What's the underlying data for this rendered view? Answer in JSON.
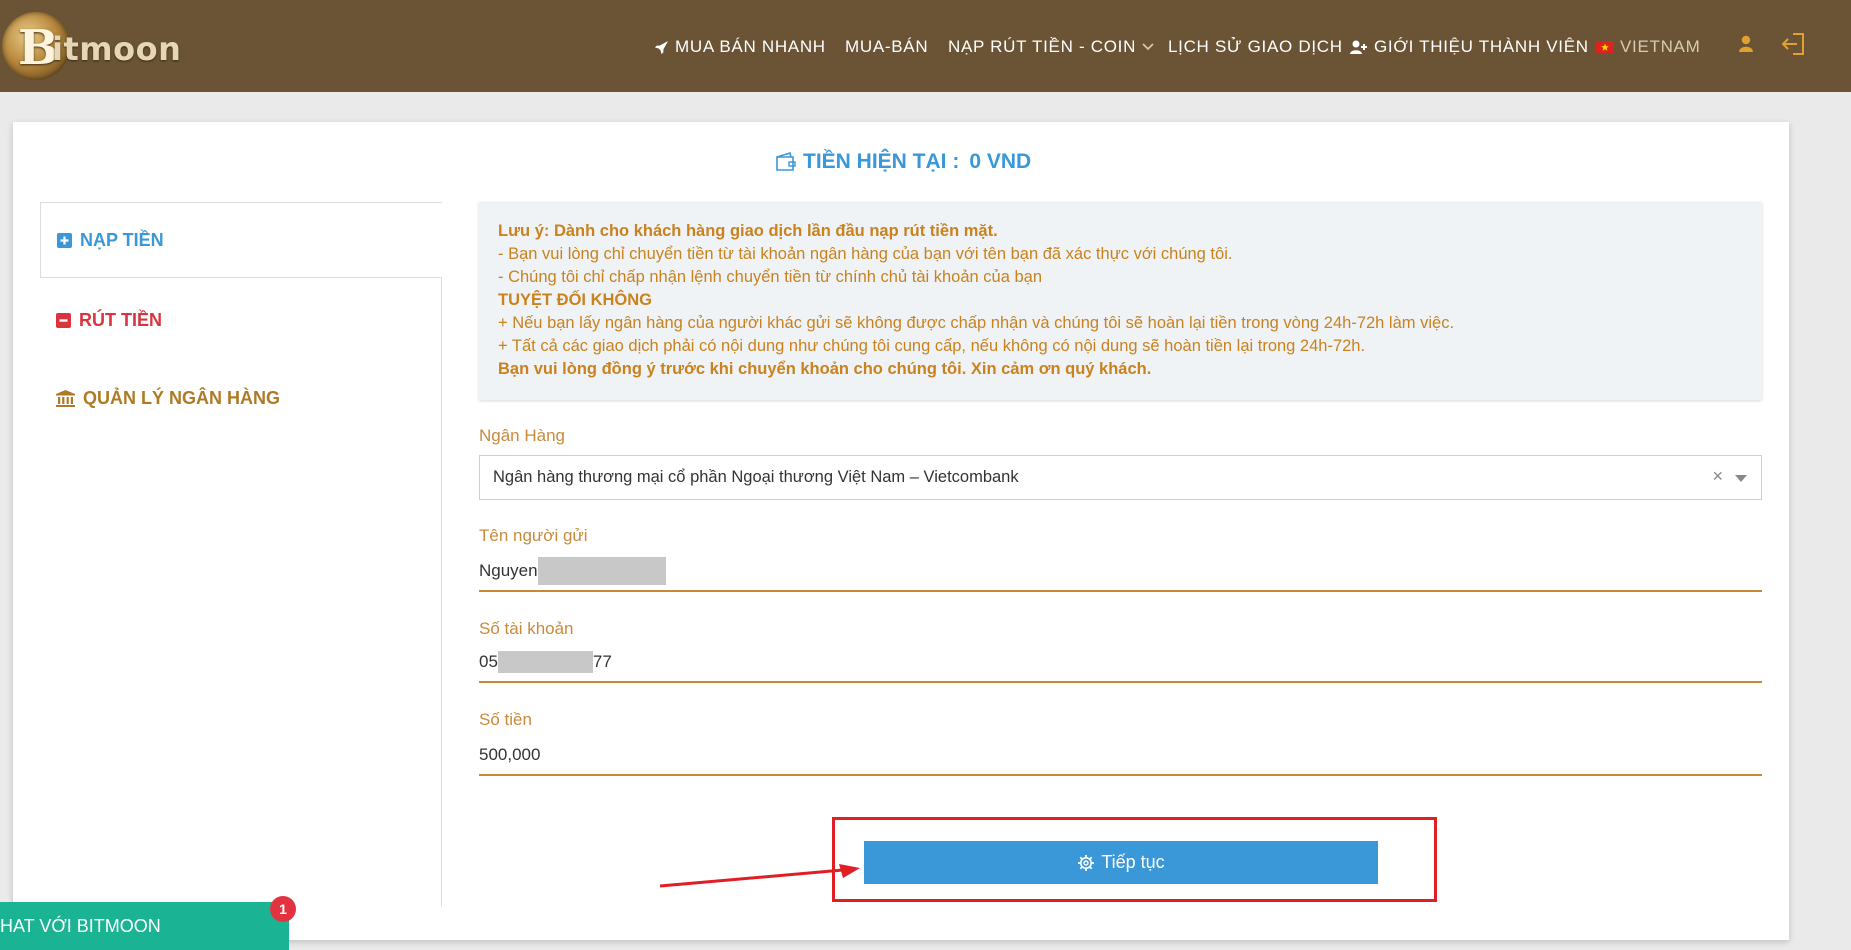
{
  "brand": {
    "logo_letter": "B",
    "logo_text": "itmoon"
  },
  "nav": {
    "items": [
      {
        "label": "MUA BÁN NHANH",
        "icon": "rocket-icon"
      },
      {
        "label": "MUA-BÁN"
      },
      {
        "label": "NẠP RÚT TIỀN - COIN",
        "icon": "chevron-down-icon"
      },
      {
        "label": "LỊCH SỬ GIAO DỊCH"
      },
      {
        "label": "GIỚI THIỆU THÀNH VIÊN",
        "icon": "user-plus-icon"
      },
      {
        "label": "VIETNAM",
        "icon": "vietnam-flag-icon"
      }
    ],
    "user_icon": "user-icon",
    "logout_icon": "sign-out-icon"
  },
  "balance": {
    "label": "TIỀN HIỆN TẠI :",
    "value": "0 VND",
    "icon": "wallet-icon"
  },
  "sidebar": {
    "items": [
      {
        "label": "NẠP TIỀN",
        "icon": "plus-square-icon",
        "active": true
      },
      {
        "label": "RÚT TIỀN",
        "icon": "minus-square-icon"
      },
      {
        "label": "QUẢN LÝ NGÂN HÀNG",
        "icon": "bank-icon"
      }
    ]
  },
  "notice": {
    "title": "Lưu ý: Dành cho khách hàng giao dịch lần đầu nạp rút tiền mặt.",
    "line1": "- Bạn vui lòng chỉ chuyển tiền từ tài khoản ngân hàng của bạn với tên bạn đã xác thực với chúng tôi.",
    "line2": "- Chúng tôi chỉ chấp nhận lệnh chuyển tiền từ chính chủ tài khoản của bạn",
    "warning": "TUYỆT ĐỐI KHÔNG",
    "line3": "+ Nếu bạn lấy ngân hàng của người khác gửi sẽ không được chấp nhận và chúng tôi sẽ hoàn lại tiền trong vòng 24h-72h làm việc.",
    "line4": "+ Tất cả các giao dịch phải có nội dung như chúng tôi cung cấp, nếu không có nội dung sẽ hoàn tiền lại trong 24h-72h.",
    "closing": "Bạn vui lòng đồng ý trước khi chuyển khoản cho chúng tôi. Xin cảm ơn quý khách."
  },
  "form": {
    "bank": {
      "label": "Ngân Hàng",
      "value": "Ngân hàng thương mại cổ phần Ngoại thương Việt Nam – Vietcombank",
      "clear": "×"
    },
    "sender": {
      "label": "Tên người gửi",
      "value_prefix": "Nguyen"
    },
    "account": {
      "label": "Số tài khoản",
      "value_prefix": "05",
      "value_suffix": "77"
    },
    "amount": {
      "label": "Số tiền",
      "value": "500,000"
    },
    "submit_label": "Tiếp tục",
    "submit_icon": "gear-icon"
  },
  "chat": {
    "label": "HAT VỚI BITMOON",
    "badge": "1"
  },
  "colors": {
    "header": "#6b5435",
    "accent": "#3a98d8",
    "gold": "#c9821d",
    "danger": "#d9343f",
    "chat": "#1ab394"
  }
}
